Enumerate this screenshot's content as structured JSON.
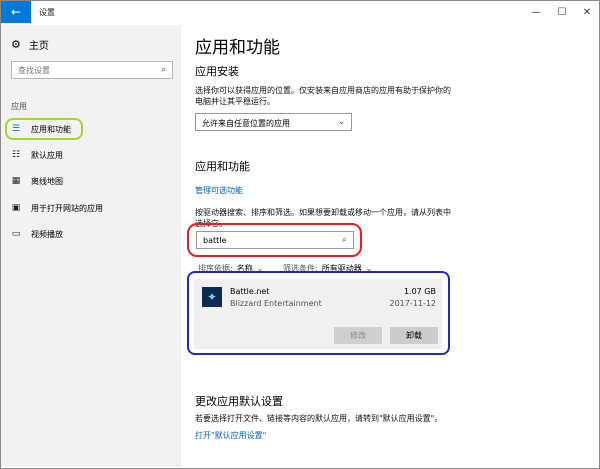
{
  "window": {
    "title": "设置",
    "back_glyph": "←",
    "min_glyph": "—",
    "max_glyph": "☐",
    "close_glyph": "✕"
  },
  "sidebar": {
    "home_label": "主页",
    "search_placeholder": "查找设置",
    "section_label": "应用",
    "items": [
      {
        "label": "应用和功能",
        "icon": "apps-features-icon",
        "active": true
      },
      {
        "label": "默认应用",
        "icon": "default-apps-icon"
      },
      {
        "label": "离线地图",
        "icon": "offline-maps-icon"
      },
      {
        "label": "用于打开网站的应用",
        "icon": "apps-for-websites-icon"
      },
      {
        "label": "视频播放",
        "icon": "video-playback-icon"
      }
    ]
  },
  "main": {
    "page_title": "应用和功能",
    "install_heading": "应用安装",
    "install_desc": "选择你可以获得应用的位置。仅安装来自应用商店的应用有助于保护你的电脑并让其平稳运行。",
    "install_dropdown_value": "允许来自任意位置的应用",
    "apps_heading": "应用和功能",
    "manage_optional_link": "管理可选功能",
    "search_desc": "按驱动器搜索、排序和筛选。如果想要卸载或移动一个应用，请从列表中选择它。",
    "search_value": "battle",
    "sort_label": "排序依据:",
    "sort_value": "名称",
    "filter_label": "筛选条件:",
    "filter_value": "所有驱动器",
    "app": {
      "name": "Battle.net",
      "publisher": "Blizzard Entertainment",
      "size": "1.07 GB",
      "date": "2017-11-12",
      "modify_label": "修改",
      "uninstall_label": "卸载"
    },
    "defaults_heading": "更改应用默认设置",
    "defaults_desc": "若要选择打开文件、链接等内容的默认应用，请转到\"默认应用设置\"。",
    "defaults_link": "打开\"默认应用设置\""
  },
  "colors": {
    "accent": "#0078d7",
    "link": "#0063b1",
    "green_highlight": "#a3d630",
    "red_highlight": "#e02424",
    "blue_highlight": "#2828b8"
  }
}
